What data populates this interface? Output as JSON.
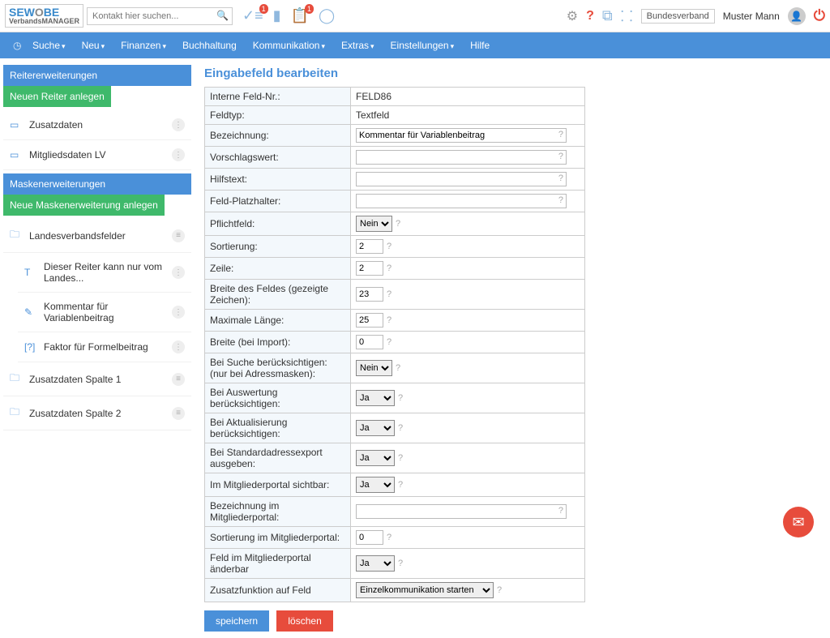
{
  "header": {
    "logo_top": "SEWOBE",
    "logo_sub": "VerbandsMANAGER",
    "search_placeholder": "Kontakt hier suchen...",
    "tasks_badge": "1",
    "clipboard_badge": "1",
    "context_chip": "Bundesverband",
    "user_name": "Muster Mann"
  },
  "nav": {
    "items": [
      {
        "label": "Suche",
        "caret": true
      },
      {
        "label": "Neu",
        "caret": true
      },
      {
        "label": "Finanzen",
        "caret": true
      },
      {
        "label": "Buchhaltung",
        "caret": false
      },
      {
        "label": "Kommunikation",
        "caret": true
      },
      {
        "label": "Extras",
        "caret": true
      },
      {
        "label": "Einstellungen",
        "caret": true
      },
      {
        "label": "Hilfe",
        "caret": false
      }
    ]
  },
  "sidebar": {
    "sec1_title": "Reitererweiterungen",
    "sec1_btn": "Neuen Reiter anlegen",
    "sec1_items": [
      {
        "label": "Zusatzdaten"
      },
      {
        "label": "Mitgliedsdaten LV"
      }
    ],
    "sec2_title": "Maskenerweiterungen",
    "sec2_btn": "Neue Maskenerweiterung anlegen",
    "sec2_items": [
      {
        "label": "Landesverbandsfelder",
        "sub": [
          {
            "icon": "T",
            "label": "Dieser Reiter kann nur vom Landes..."
          },
          {
            "icon": "✎",
            "label": "Kommentar für Variablenbeitrag"
          },
          {
            "icon": "[?]",
            "label": "Faktor für Formelbeitrag"
          }
        ]
      },
      {
        "label": "Zusatzdaten Spalte 1"
      },
      {
        "label": "Zusatzdaten Spalte 2"
      }
    ]
  },
  "page": {
    "title": "Eingabefeld bearbeiten",
    "rows": {
      "feldnr_lbl": "Interne Feld-Nr.:",
      "feldnr_val": "FELD86",
      "feldtyp_lbl": "Feldtyp:",
      "feldtyp_val": "Textfeld",
      "bez_lbl": "Bezeichnung:",
      "bez_val": "Kommentar für Variablenbeitrag",
      "vorschlag_lbl": "Vorschlagswert:",
      "vorschlag_val": "",
      "hilf_lbl": "Hilfstext:",
      "hilf_val": "",
      "platz_lbl": "Feld-Platzhalter:",
      "platz_val": "",
      "pflicht_lbl": "Pflichtfeld:",
      "pflicht_val": "Nein",
      "sort_lbl": "Sortierung:",
      "sort_val": "2",
      "zeile_lbl": "Zeile:",
      "zeile_val": "2",
      "breite_lbl": "Breite des Feldes (gezeigte Zeichen):",
      "breite_val": "23",
      "maxlen_lbl": "Maximale Länge:",
      "maxlen_val": "25",
      "breiteimp_lbl": "Breite (bei Import):",
      "breiteimp_val": "0",
      "suche_lbl": "Bei Suche berücksichtigen: (nur bei Adressmasken):",
      "suche_val": "Nein",
      "ausw_lbl": "Bei Auswertung berücksichtigen:",
      "ausw_val": "Ja",
      "aktual_lbl": "Bei Aktualisierung berücksichtigen:",
      "aktual_val": "Ja",
      "stdexp_lbl": "Bei Standardadressexport ausgeben:",
      "stdexp_val": "Ja",
      "portsicht_lbl": "Im Mitgliederportal sichtbar:",
      "portsicht_val": "Ja",
      "bezport_lbl": "Bezeichnung im Mitgliederportal:",
      "bezport_val": "",
      "sortport_lbl": "Sortierung im Mitgliederportal:",
      "sortport_val": "0",
      "aendport_lbl": "Feld im Mitgliederportal änderbar",
      "aendport_val": "Ja",
      "zusatz_lbl": "Zusatzfunktion auf Feld",
      "zusatz_val": "Einzelkommunikation starten"
    },
    "btn_save": "speichern",
    "btn_del": "löschen"
  }
}
